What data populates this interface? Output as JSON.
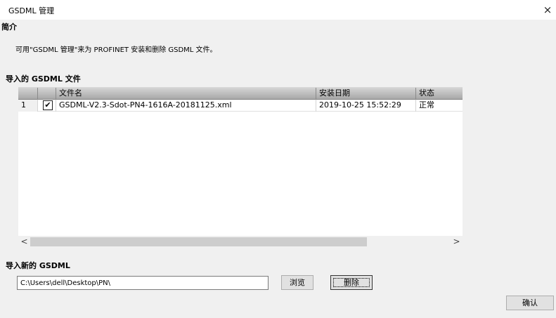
{
  "window": {
    "title": "GSDML 管理",
    "close_glyph": "×"
  },
  "intro": {
    "heading": "简介",
    "text": "可用\"GSDML 管理\"来为 PROFINET 安装和删除 GSDML 文件。"
  },
  "imported": {
    "heading": "导入的 GSDML 文件",
    "columns": [
      "",
      "",
      "文件名",
      "安装日期",
      "状态"
    ],
    "rows": [
      {
        "num": "1",
        "checked": "✔",
        "file": "GSDML-V2.3-Sdot-PN4-1616A-20181125.xml",
        "date": "2019-10-25 15:52:29",
        "status": "正常"
      }
    ],
    "scroll_left": "<",
    "scroll_right": ">"
  },
  "import_new": {
    "heading": "导入新的 GSDML",
    "path_value": "C:\\Users\\dell\\Desktop\\PN\\",
    "browse_label": "浏览",
    "delete_label": "删除"
  },
  "confirm_label": "确认"
}
